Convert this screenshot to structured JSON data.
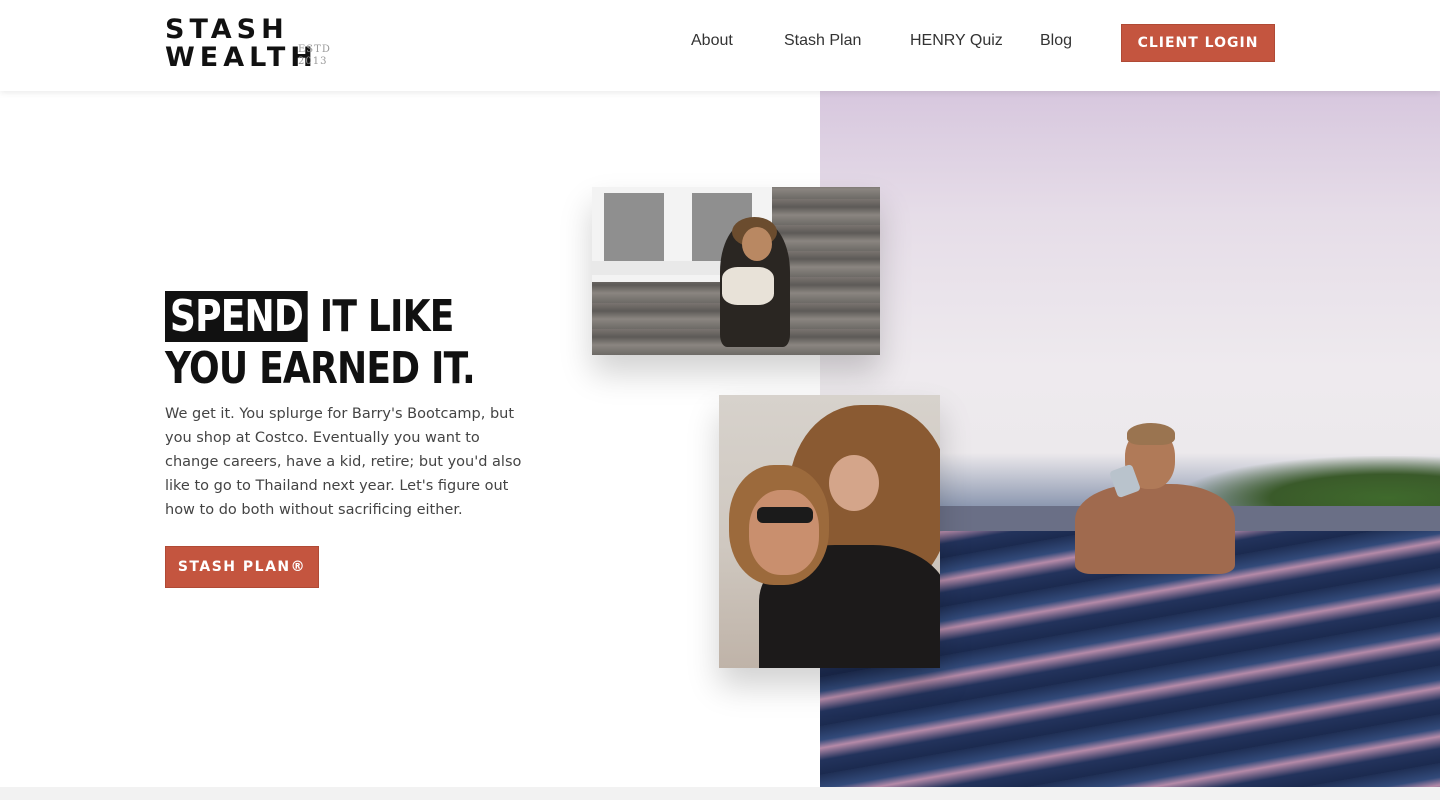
{
  "brand": {
    "logo_line1": "STASH",
    "logo_line2": "WEALTH",
    "estd_line1": "ESTD",
    "estd_line2": "2013",
    "accent_color": "#c4553f"
  },
  "nav": {
    "items": [
      "About",
      "Stash Plan",
      "HENRY Quiz",
      "Blog"
    ],
    "login_label": "CLIENT LOGIN"
  },
  "hero": {
    "headline_highlight": "SPEND",
    "headline_rest_line1": "IT LIKE",
    "headline_line2": "YOU EARNED IT.",
    "body": "We get it. You splurge for Barry's Bootcamp, but you shop at Costco. Eventually you want to change careers, have a kid, retire; but you'd also like to go to Thailand next year. Let's figure out how to do both without sacrificing either.",
    "cta_label": "STASH PLAN®"
  }
}
